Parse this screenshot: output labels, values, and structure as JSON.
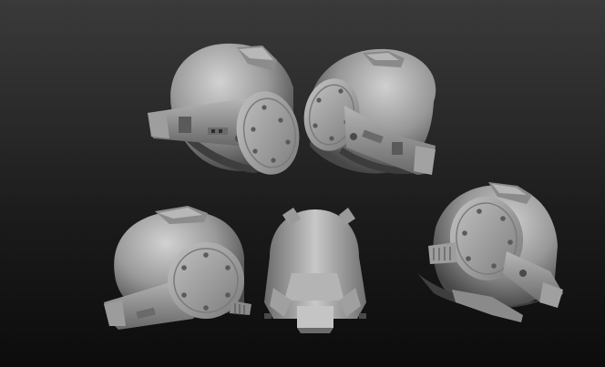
{
  "scene": {
    "subject": "helmet-render",
    "views": [
      {
        "id": "top-left",
        "label": ""
      },
      {
        "id": "top-right",
        "label": ""
      },
      {
        "id": "bottom-left",
        "label": ""
      },
      {
        "id": "bottom-center",
        "label": ""
      },
      {
        "id": "bottom-right",
        "label": ""
      }
    ]
  },
  "colors": {
    "background_top": "#3a3a3a",
    "background_bottom": "#0c0c0c",
    "material_light": "#c9c9c9",
    "material_mid": "#8e8e8e",
    "material_dark": "#3c3c3c"
  }
}
